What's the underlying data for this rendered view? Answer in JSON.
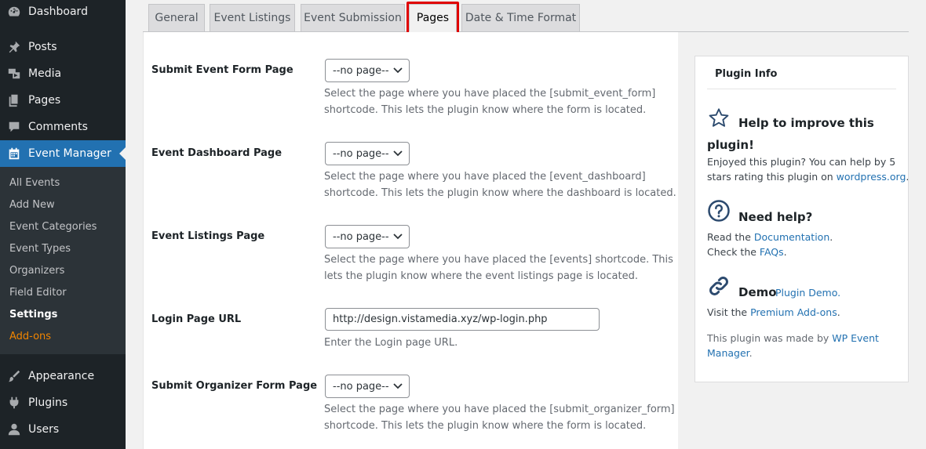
{
  "sidebar": {
    "items": [
      {
        "label": "Dashboard",
        "icon": "dashboard-icon"
      },
      {
        "label": "Posts",
        "icon": "pin-icon"
      },
      {
        "label": "Media",
        "icon": "media-icon"
      },
      {
        "label": "Pages",
        "icon": "pages-icon"
      },
      {
        "label": "Comments",
        "icon": "comment-icon"
      },
      {
        "label": "Event Manager",
        "icon": "calendar-icon"
      },
      {
        "label": "Appearance",
        "icon": "brush-icon"
      },
      {
        "label": "Plugins",
        "icon": "plugin-icon"
      },
      {
        "label": "Users",
        "icon": "user-icon"
      }
    ],
    "submenu": [
      "All Events",
      "Add New",
      "Event Categories",
      "Event Types",
      "Organizers",
      "Field Editor",
      "Settings",
      "Add-ons"
    ]
  },
  "tabs": [
    "General",
    "Event Listings",
    "Event Submission",
    "Pages",
    "Date & Time Format"
  ],
  "settings": {
    "rows": [
      {
        "label": "Submit Event Form Page",
        "value": "--no page--",
        "desc1": "Select the page where you have placed the [submit_event_form]",
        "desc2": "shortcode. This lets the plugin know where the form is located."
      },
      {
        "label": "Event Dashboard Page",
        "value": "--no page--",
        "desc1": "Select the page where you have placed the [event_dashboard]",
        "desc2": "shortcode. This lets the plugin know where the dashboard is located."
      },
      {
        "label": "Event Listings Page",
        "value": "--no page--",
        "desc1": "Select the page where you have placed the [events] shortcode. This",
        "desc2": "lets the plugin know where the event listings page is located."
      },
      {
        "label": "Login Page URL",
        "value": "http://design.vistamedia.xyz/wp-login.php",
        "desc1": "Enter the Login page URL."
      },
      {
        "label": "Submit Organizer Form Page",
        "value": "--no page--",
        "desc1": "Select the page where you have placed the [submit_organizer_form]",
        "desc2": "shortcode. This lets the plugin know where the form is located."
      }
    ]
  },
  "info": {
    "title": "Plugin Info",
    "improve_heading_1": "Help to improve this",
    "improve_heading_2": "plugin!",
    "improve_text_1": "Enjoyed this plugin? You can help by 5",
    "improve_text_2": "stars rating this plugin on ",
    "improve_link": "wordpress.org",
    "improve_end": ".",
    "help_heading": "Need help?",
    "help_read": "Read the ",
    "help_doc_link": "Documentation",
    "help_dot1": ".",
    "help_check": "Check the ",
    "help_faq_link": "FAQs",
    "help_dot2": ".",
    "demo_heading": "Demo",
    "demo_link": "Plugin Demo.",
    "visit_text": "Visit the ",
    "visit_link": "Premium Add-ons",
    "visit_end": ".",
    "made_text": "This plugin was made by ",
    "made_link_1": "WP Event",
    "made_link_2": "Manager",
    "made_end": "."
  },
  "colors": {
    "accent": "#2271b1",
    "highlight": "#e00000",
    "addons": "#f18500"
  }
}
